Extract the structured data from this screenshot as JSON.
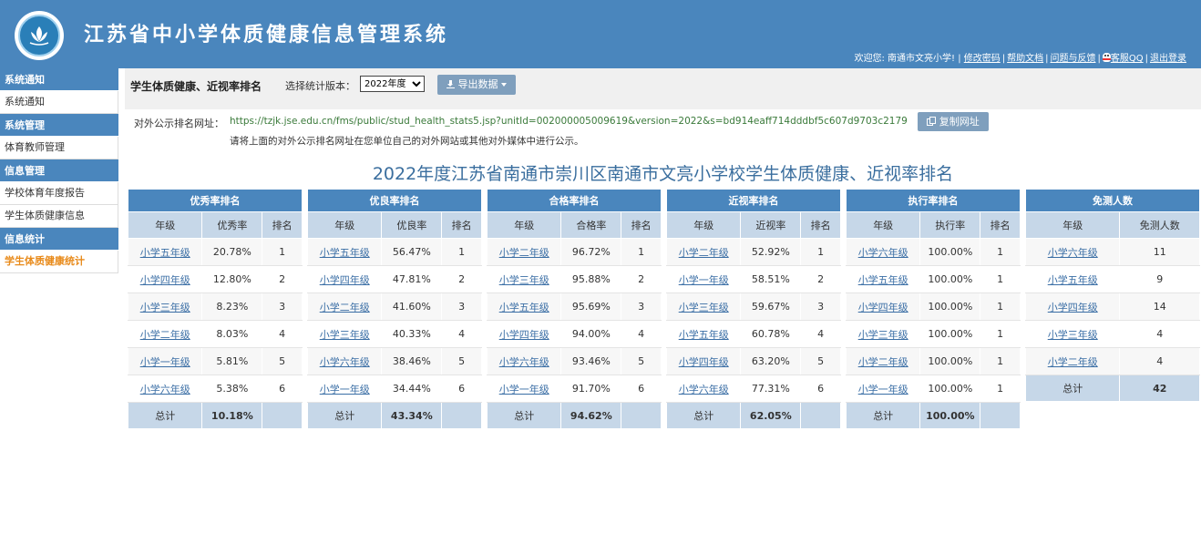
{
  "header": {
    "app_title": "江苏省中小学体质健康信息管理系统",
    "welcome": "欢迎您: 南通市文亮小学! |",
    "links": [
      "修改密码",
      "帮助文档",
      "问题与反馈",
      "客服QQ",
      "退出登录"
    ]
  },
  "sidebar": {
    "sections": [
      {
        "title": "系统通知",
        "items": [
          "系统通知"
        ]
      },
      {
        "title": "系统管理",
        "items": [
          "体育教师管理"
        ]
      },
      {
        "title": "信息管理",
        "items": [
          "学校体育年度报告",
          "学生体质健康信息"
        ]
      },
      {
        "title": "信息统计",
        "items": [
          "学生体质健康统计"
        ]
      }
    ],
    "active_item": "学生体质健康统计"
  },
  "toolbar": {
    "heading": "学生体质健康、近视率排名",
    "version_label": "选择统计版本：",
    "version_value": "2022年度",
    "export_label": "导出数据"
  },
  "public_url": {
    "label": "对外公示排名网址：",
    "url": "https://tzjk.jse.edu.cn/fms/public/stud_health_stats5.jsp?unitId=002000005009619&version=2022&s=bd914eaff714dddbf5c607d9703c2179",
    "copy_label": "复制网址",
    "note": "请将上面的对外公示排名网址在您单位自己的对外网站或其他对外媒体中进行公示。"
  },
  "report_title": "2022年度江苏省南通市崇川区南通市文亮小学校学生体质健康、近视率排名",
  "tables": [
    {
      "title": "优秀率排名",
      "columns": [
        "年级",
        "优秀率",
        "排名"
      ],
      "rows": [
        [
          "小学五年级",
          "20.78%",
          "1"
        ],
        [
          "小学四年级",
          "12.80%",
          "2"
        ],
        [
          "小学三年级",
          "8.23%",
          "3"
        ],
        [
          "小学二年级",
          "8.03%",
          "4"
        ],
        [
          "小学一年级",
          "5.81%",
          "5"
        ],
        [
          "小学六年级",
          "5.38%",
          "6"
        ]
      ],
      "total": [
        "总计",
        "10.18%",
        ""
      ]
    },
    {
      "title": "优良率排名",
      "columns": [
        "年级",
        "优良率",
        "排名"
      ],
      "rows": [
        [
          "小学五年级",
          "56.47%",
          "1"
        ],
        [
          "小学四年级",
          "47.81%",
          "2"
        ],
        [
          "小学二年级",
          "41.60%",
          "3"
        ],
        [
          "小学三年级",
          "40.33%",
          "4"
        ],
        [
          "小学六年级",
          "38.46%",
          "5"
        ],
        [
          "小学一年级",
          "34.44%",
          "6"
        ]
      ],
      "total": [
        "总计",
        "43.34%",
        ""
      ]
    },
    {
      "title": "合格率排名",
      "columns": [
        "年级",
        "合格率",
        "排名"
      ],
      "rows": [
        [
          "小学二年级",
          "96.72%",
          "1"
        ],
        [
          "小学三年级",
          "95.88%",
          "2"
        ],
        [
          "小学五年级",
          "95.69%",
          "3"
        ],
        [
          "小学四年级",
          "94.00%",
          "4"
        ],
        [
          "小学六年级",
          "93.46%",
          "5"
        ],
        [
          "小学一年级",
          "91.70%",
          "6"
        ]
      ],
      "total": [
        "总计",
        "94.62%",
        ""
      ]
    },
    {
      "title": "近视率排名",
      "columns": [
        "年级",
        "近视率",
        "排名"
      ],
      "rows": [
        [
          "小学二年级",
          "52.92%",
          "1"
        ],
        [
          "小学一年级",
          "58.51%",
          "2"
        ],
        [
          "小学三年级",
          "59.67%",
          "3"
        ],
        [
          "小学五年级",
          "60.78%",
          "4"
        ],
        [
          "小学四年级",
          "63.20%",
          "5"
        ],
        [
          "小学六年级",
          "77.31%",
          "6"
        ]
      ],
      "total": [
        "总计",
        "62.05%",
        ""
      ]
    },
    {
      "title": "执行率排名",
      "columns": [
        "年级",
        "执行率",
        "排名"
      ],
      "rows": [
        [
          "小学六年级",
          "100.00%",
          "1"
        ],
        [
          "小学五年级",
          "100.00%",
          "1"
        ],
        [
          "小学四年级",
          "100.00%",
          "1"
        ],
        [
          "小学三年级",
          "100.00%",
          "1"
        ],
        [
          "小学二年级",
          "100.00%",
          "1"
        ],
        [
          "小学一年级",
          "100.00%",
          "1"
        ]
      ],
      "total": [
        "总计",
        "100.00%",
        ""
      ]
    },
    {
      "title": "免测人数",
      "columns": [
        "年级",
        "免测人数"
      ],
      "rows": [
        [
          "小学六年级",
          "11"
        ],
        [
          "小学五年级",
          "9"
        ],
        [
          "小学四年级",
          "14"
        ],
        [
          "小学三年级",
          "4"
        ],
        [
          "小学二年级",
          "4"
        ]
      ],
      "total": [
        "总计",
        "42"
      ]
    }
  ],
  "colors": {
    "header_bg": "#4a86bd",
    "column_head_bg": "#c6d7e8",
    "active_menu": "#e88a1a",
    "link": "#3a6ea5",
    "url_text": "#3a7a3a",
    "title_text": "#3a6e9e"
  },
  "icons": {
    "logo": "lotus-logo-icon",
    "export": "download-icon",
    "copy": "copy-icon",
    "qq": "qq-penguin-icon"
  }
}
